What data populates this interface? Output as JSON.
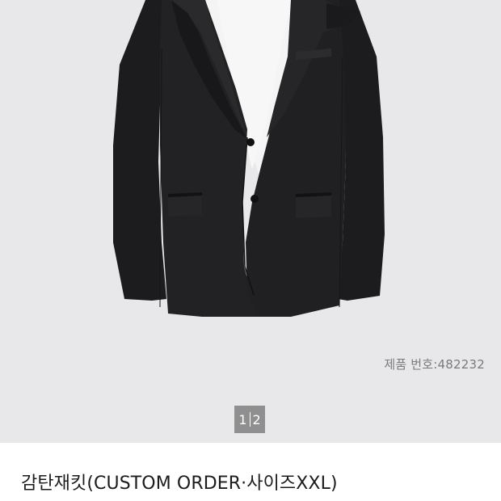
{
  "product": {
    "number_text": "제품 번호:482232",
    "title": "감탄재킷(CUSTOM ORDER·사이즈XXL)"
  },
  "pager": {
    "current": "1",
    "total": "2"
  },
  "image": {
    "background_color": "#e8e8ea",
    "jacket_color": "#1f1f21",
    "shirt_color": "#f5f5f5"
  }
}
